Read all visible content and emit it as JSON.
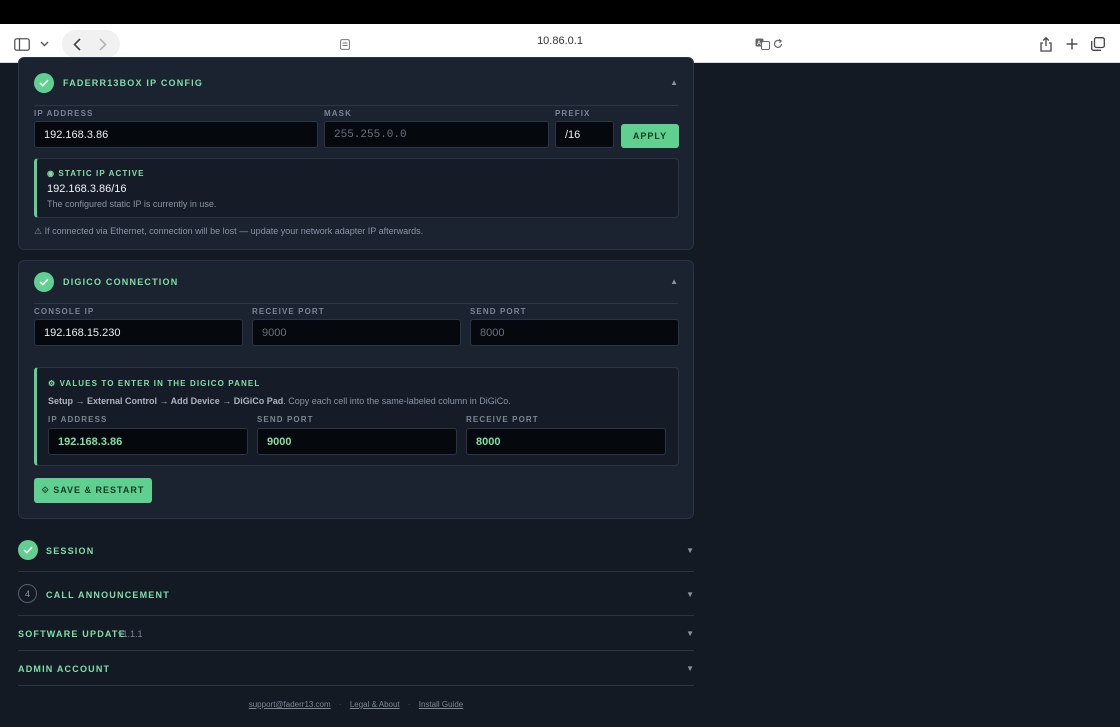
{
  "browser": {
    "url": "10.86.0.1"
  },
  "ip_config": {
    "title": "FADERR13BOX IP CONFIG",
    "caret": "▲",
    "ip_label": "IP ADDRESS",
    "ip_value": "192.168.3.86",
    "mask_label": "MASK",
    "mask_placeholder": "255.255.0.0",
    "prefix_label": "PREFIX",
    "prefix_value": "/16",
    "apply_label": "APPLY",
    "status_title": "◉ STATIC IP ACTIVE",
    "status_value": "192.168.3.86/16",
    "status_desc": "The configured static IP is currently in use.",
    "warning": "⚠ If connected via Ethernet, connection will be lost — update your network adapter IP afterwards."
  },
  "digico": {
    "title": "DIGICO CONNECTION",
    "caret": "▲",
    "console_ip_label": "CONSOLE IP",
    "console_ip_value": "192.168.15.230",
    "receive_port_label": "RECEIVE PORT",
    "receive_port_placeholder": "9000",
    "send_port_label": "SEND PORT",
    "send_port_placeholder": "8000",
    "panel_title": "⚙ VALUES TO ENTER IN THE DIGICO PANEL",
    "panel_path": "Setup → External Control → Add Device → DiGiCo Pad",
    "panel_desc": ". Copy each cell into the same-labeled column in DiGiCo.",
    "panel_ip_label": "IP ADDRESS",
    "panel_ip_value": "192.168.3.86",
    "panel_send_label": "SEND PORT",
    "panel_send_value": "9000",
    "panel_receive_label": "RECEIVE PORT",
    "panel_receive_value": "8000",
    "save_label": "⟐ SAVE & RESTART"
  },
  "sections": {
    "session": {
      "title": "SESSION",
      "caret": "▼"
    },
    "call": {
      "number": "4",
      "title": "CALL ANNOUNCEMENT",
      "caret": "▼"
    },
    "software": {
      "title": "SOFTWARE UPDATE",
      "version": "v1.1.1",
      "caret": "▼"
    },
    "admin": {
      "title": "ADMIN ACCOUNT",
      "caret": "▼"
    }
  },
  "footer": {
    "email": "support@faderr13.com",
    "legal": "Legal & About",
    "guide": "Install Guide",
    "separator": "·"
  },
  "colors": {
    "accent": "#5fd08f",
    "background": "#141a24",
    "card": "#1b2230"
  }
}
